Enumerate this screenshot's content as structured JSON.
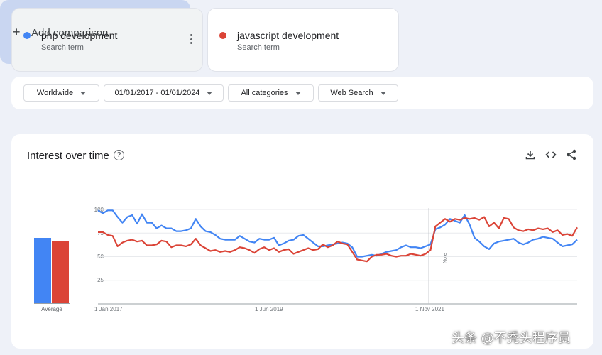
{
  "terms": [
    {
      "name": "php development",
      "sub": "Search term",
      "color": "#4285f4"
    },
    {
      "name": "javascript development",
      "sub": "Search term",
      "color": "#db4437"
    }
  ],
  "add_comparison": {
    "label": "Add comparison",
    "icon": "plus-icon"
  },
  "filters": {
    "region": "Worldwide",
    "date_range": "01/01/2017 - 01/01/2024",
    "category": "All categories",
    "search_type": "Web Search"
  },
  "chart": {
    "title": "Interest over time",
    "help_icon": "help-circle-icon",
    "actions": [
      "download-icon",
      "embed-code-icon",
      "share-icon"
    ],
    "average_label": "Average",
    "note_label": "Note"
  },
  "chart_data": {
    "type": "line",
    "title": "Interest over time",
    "xlabel": "",
    "ylabel": "",
    "ylim": [
      0,
      100
    ],
    "y_ticks": [
      "25",
      "50",
      "75",
      "100"
    ],
    "x_ticks": [
      "1 Jan 2017",
      "1 Jun 2019",
      "1 Nov 2021"
    ],
    "x_start": "2017-01-01",
    "x_end": "2024-01-01",
    "grid": true,
    "annotations": [
      {
        "label": "Note",
        "x": "2021-11-01"
      }
    ],
    "averages": [
      {
        "name": "php development",
        "value": 70
      },
      {
        "name": "javascript development",
        "value": 66
      }
    ],
    "series": [
      {
        "name": "php development",
        "color": "#4285f4",
        "values": [
          99,
          96,
          99,
          99,
          92,
          86,
          92,
          94,
          85,
          95,
          86,
          86,
          80,
          83,
          80,
          80,
          77,
          77,
          78,
          80,
          90,
          82,
          77,
          76,
          73,
          69,
          68,
          68,
          68,
          72,
          69,
          66,
          65,
          69,
          68,
          68,
          70,
          62,
          64,
          67,
          68,
          72,
          73,
          69,
          65,
          61,
          61,
          62,
          63,
          64,
          65,
          64,
          60,
          50,
          50,
          51,
          52,
          51,
          53,
          55,
          56,
          57,
          60,
          62,
          60,
          60,
          59,
          61,
          63,
          79,
          81,
          84,
          90,
          88,
          86,
          94,
          84,
          70,
          66,
          61,
          58,
          64,
          66,
          67,
          68,
          69,
          65,
          63,
          65,
          68,
          69,
          71,
          70,
          69,
          65,
          61,
          62,
          63,
          68
        ]
      },
      {
        "name": "javascript development",
        "color": "#db4437",
        "values": [
          76,
          76,
          73,
          72,
          61,
          65,
          67,
          68,
          66,
          67,
          62,
          62,
          63,
          67,
          66,
          60,
          62,
          62,
          61,
          63,
          69,
          62,
          59,
          56,
          57,
          55,
          56,
          55,
          57,
          60,
          59,
          57,
          54,
          58,
          60,
          57,
          59,
          55,
          57,
          58,
          53,
          55,
          57,
          59,
          57,
          58,
          63,
          60,
          62,
          66,
          64,
          63,
          55,
          47,
          46,
          45,
          50,
          52,
          52,
          53,
          51,
          50,
          51,
          51,
          53,
          52,
          51,
          53,
          57,
          82,
          86,
          90,
          87,
          90,
          89,
          91,
          90,
          91,
          89,
          92,
          82,
          86,
          80,
          91,
          90,
          81,
          78,
          77,
          79,
          78,
          80,
          79,
          80,
          76,
          78,
          73,
          74,
          72,
          81
        ]
      }
    ]
  }
}
